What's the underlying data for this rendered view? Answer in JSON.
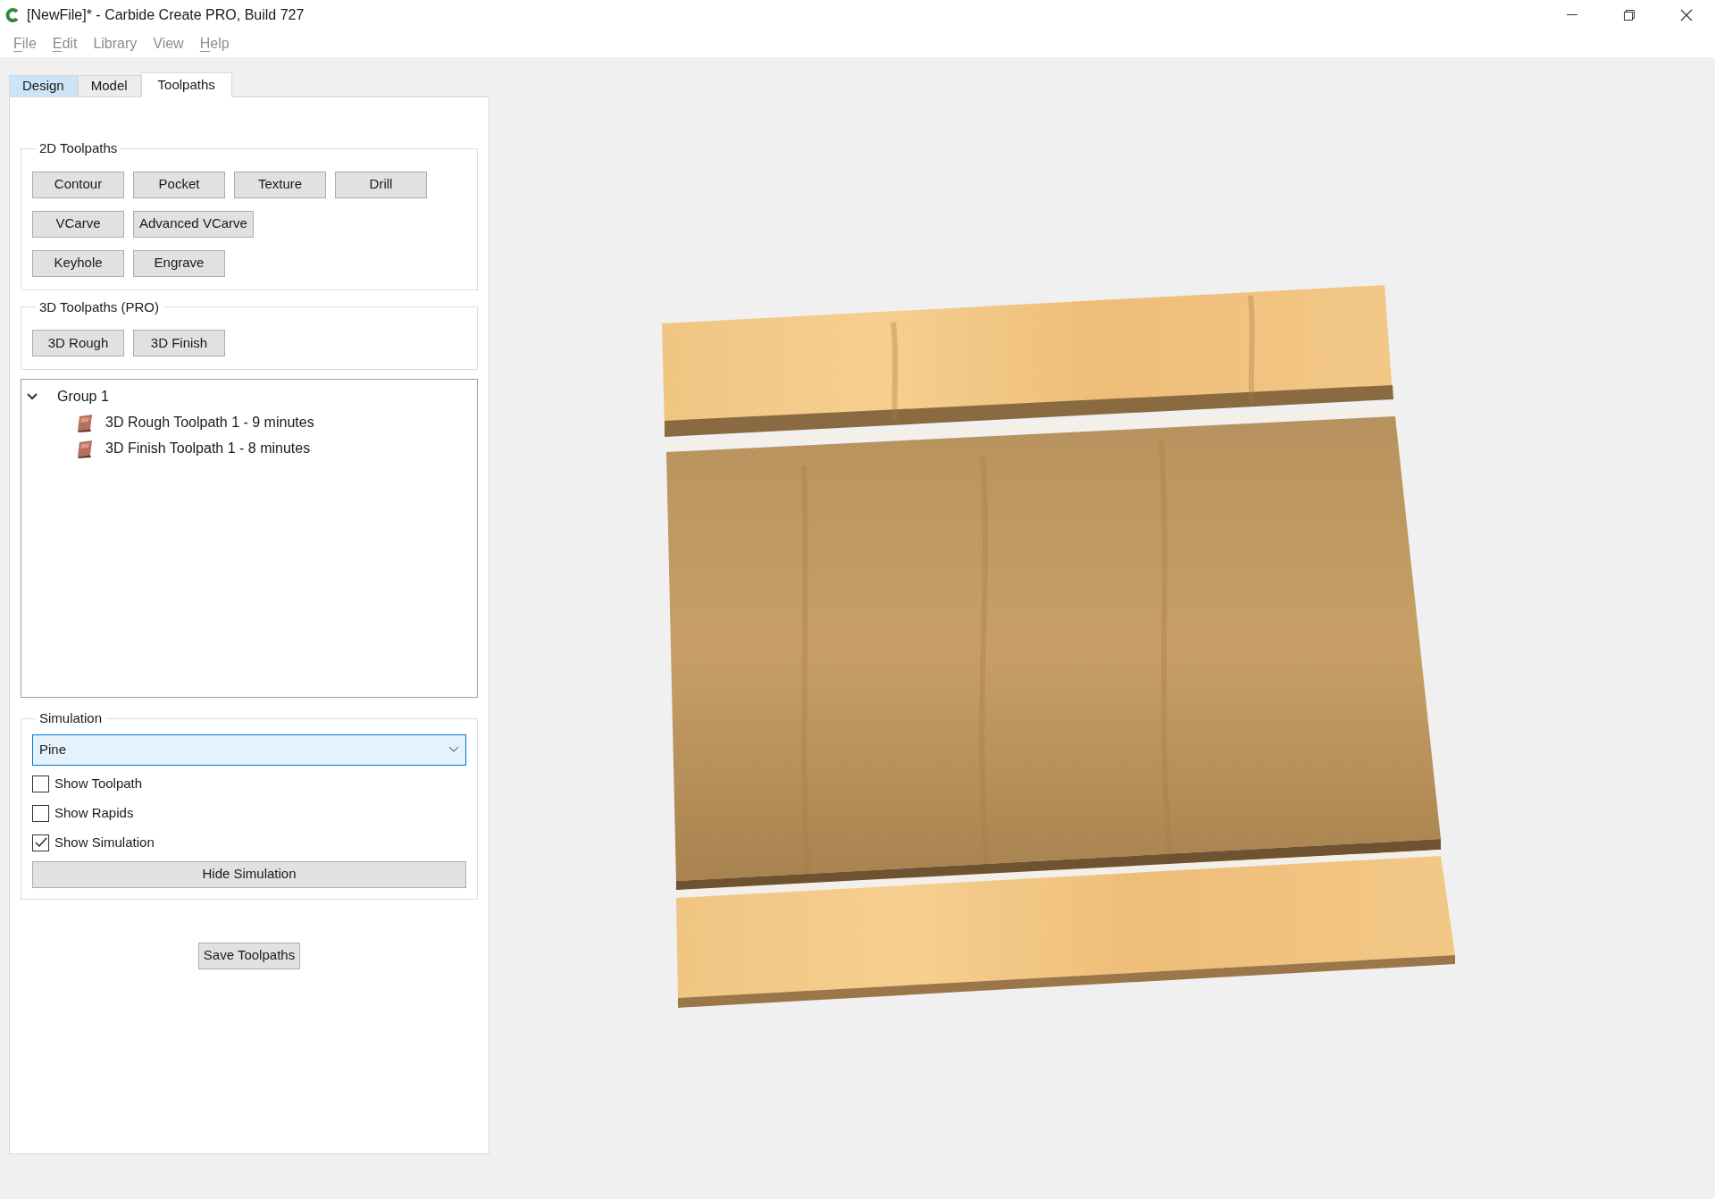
{
  "window": {
    "title": "[NewFile]* - Carbide Create PRO, Build 727"
  },
  "menu": [
    {
      "label": "File",
      "mnemonic": true
    },
    {
      "label": "Edit",
      "mnemonic": true
    },
    {
      "label": "Library",
      "mnemonic": false
    },
    {
      "label": "View",
      "mnemonic": false
    },
    {
      "label": "Help",
      "mnemonic": true
    }
  ],
  "tabs": [
    {
      "label": "Design",
      "selected": false,
      "highlighted": true
    },
    {
      "label": "Model",
      "selected": false,
      "highlighted": false
    },
    {
      "label": "Toolpaths",
      "selected": true,
      "highlighted": false
    }
  ],
  "toolpaths_2d": {
    "title": "2D Toolpaths",
    "rows": [
      [
        "Contour",
        "Pocket",
        "Texture",
        "Drill"
      ],
      [
        "VCarve",
        "Advanced VCarve"
      ],
      [
        "Keyhole",
        "Engrave"
      ]
    ]
  },
  "toolpaths_3d": {
    "title": "3D Toolpaths (PRO)",
    "buttons": [
      "3D Rough",
      "3D Finish"
    ]
  },
  "tree": [
    {
      "label": "Group 1",
      "expanded": true,
      "children": [
        {
          "label": "3D Rough Toolpath 1 - 9 minutes"
        },
        {
          "label": "3D Finish Toolpath 1 - 8 minutes"
        }
      ]
    }
  ],
  "simulation": {
    "title": "Simulation",
    "material": "Pine",
    "options": [
      {
        "label": "Show Toolpath",
        "checked": false
      },
      {
        "label": "Show Rapids",
        "checked": false
      },
      {
        "label": "Show Simulation",
        "checked": true
      }
    ],
    "button": "Hide Simulation"
  },
  "save_button": "Save Toolpaths"
}
